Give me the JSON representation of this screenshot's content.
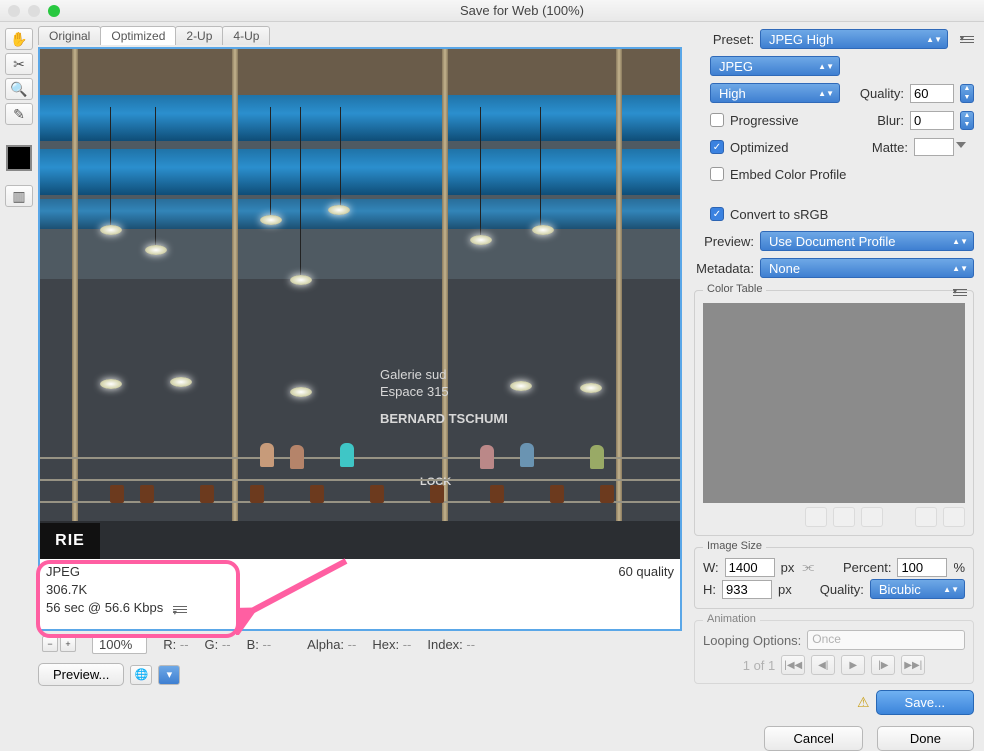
{
  "window": {
    "title": "Save for Web (100%)"
  },
  "tabs": {
    "original": "Original",
    "optimized": "Optimized",
    "twoup": "2-Up",
    "fourup": "4-Up"
  },
  "preview_info": {
    "format": "JPEG",
    "size": "306.7K",
    "timing": "56 sec @ 56.6 Kbps",
    "quality_label": "60 quality"
  },
  "image_text": {
    "stripe": "RIE",
    "sign1": "Galerie sud",
    "sign2": "Espace 315",
    "sign3": "BERNARD TSCHUMI",
    "sign4": "LOCK"
  },
  "statusbar": {
    "zoom": "100%",
    "r": "R:",
    "g": "G:",
    "b": "B:",
    "alpha": "Alpha:",
    "hex": "Hex:",
    "index": "Index:",
    "dash": "--",
    "preview_btn": "Preview..."
  },
  "panel": {
    "preset_label": "Preset:",
    "preset_value": "JPEG High",
    "format": "JPEG",
    "quality_preset": "High",
    "quality_label": "Quality:",
    "quality_value": "60",
    "progressive": "Progressive",
    "blur_label": "Blur:",
    "blur_value": "0",
    "optimized": "Optimized",
    "matte_label": "Matte:",
    "embed": "Embed Color Profile",
    "convert": "Convert to sRGB",
    "preview_label": "Preview:",
    "preview_value": "Use Document Profile",
    "metadata_label": "Metadata:",
    "metadata_value": "None",
    "color_table": "Color Table",
    "image_size": "Image Size",
    "w_label": "W:",
    "w_value": "1400",
    "px": "px",
    "h_label": "H:",
    "h_value": "933",
    "percent_label": "Percent:",
    "percent_value": "100",
    "percent_unit": "%",
    "q2_label": "Quality:",
    "q2_value": "Bicubic",
    "animation": "Animation",
    "loop_label": "Looping Options:",
    "loop_value": "Once",
    "frame": "1 of 1"
  },
  "buttons": {
    "save": "Save...",
    "cancel": "Cancel",
    "done": "Done"
  }
}
